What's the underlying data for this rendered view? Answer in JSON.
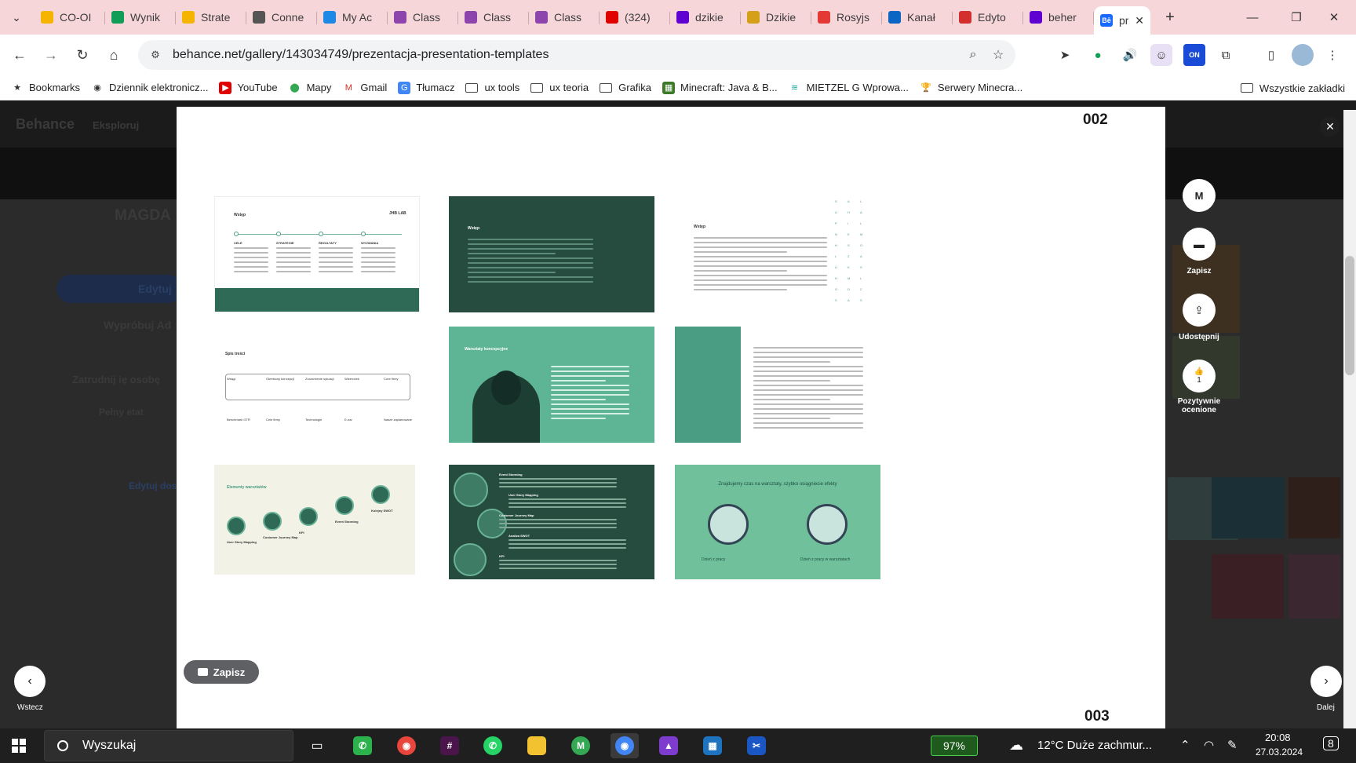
{
  "browser": {
    "tabs": [
      {
        "title": "CO-OI",
        "icon": "google-drive-icon",
        "color": "#f4b400"
      },
      {
        "title": "Wynik",
        "icon": "google-drive-icon",
        "color": "#0f9d58"
      },
      {
        "title": "Strate",
        "icon": "google-slides-icon",
        "color": "#f4b400"
      },
      {
        "title": "Conne",
        "icon": "apple-icon",
        "color": "#555555"
      },
      {
        "title": "My Ac",
        "icon": "grid-app-icon",
        "color": "#1e88e5"
      },
      {
        "title": "Class",
        "icon": "class-icon",
        "color": "#8e44ad"
      },
      {
        "title": "Class",
        "icon": "class-icon",
        "color": "#8e44ad"
      },
      {
        "title": "Class",
        "icon": "class-icon",
        "color": "#8e44ad"
      },
      {
        "title": "(324)",
        "icon": "youtube-icon",
        "color": "#e00000"
      },
      {
        "title": "dzikie",
        "icon": "yahoo-icon",
        "color": "#5f01d1"
      },
      {
        "title": "Dzikie",
        "icon": "brain-icon",
        "color": "#d4a017"
      },
      {
        "title": "Rosyjs",
        "icon": "dots-icon",
        "color": "#e53935"
      },
      {
        "title": "Kanał",
        "icon": "linkedin-icon",
        "color": "#0a66c2"
      },
      {
        "title": "Edyto",
        "icon": "nm-icon",
        "color": "#d32f2f"
      },
      {
        "title": "beher",
        "icon": "yahoo-icon",
        "color": "#5f01d1"
      }
    ],
    "active_tab": {
      "title": "pr",
      "icon": "behance-icon",
      "color": "#1769ff",
      "badge": "Bē"
    },
    "url": "behance.net/gallery/143034749/prezentacja-presentation-templates",
    "bookmarks": [
      {
        "label": "Bookmarks",
        "icon": "star-icon"
      },
      {
        "label": "Dziennik elektronicz...",
        "icon": "globe-icon"
      },
      {
        "label": "YouTube",
        "icon": "youtube-icon"
      },
      {
        "label": "Mapy",
        "icon": "maps-icon"
      },
      {
        "label": "Gmail",
        "icon": "gmail-icon"
      },
      {
        "label": "Tłumacz",
        "icon": "translate-icon"
      },
      {
        "label": "ux tools",
        "icon": "folder-icon"
      },
      {
        "label": "ux teoria",
        "icon": "folder-icon"
      },
      {
        "label": "Grafika",
        "icon": "folder-icon"
      },
      {
        "label": "Minecraft: Java & B...",
        "icon": "minecraft-icon"
      },
      {
        "label": "MIETZEL G Wprowa...",
        "icon": "layers-icon"
      },
      {
        "label": "Serwery Minecra...",
        "icon": "trophy-icon"
      }
    ],
    "all_bookmarks": "Wszystkie zakładki"
  },
  "background_page": {
    "logo": "Behance",
    "explore": "Eksploruj",
    "name": "MAGDA",
    "edit": "Edytuj",
    "try": "Wypróbuj Ad",
    "hire": "Zatrudnij ię osobę",
    "fulltime": "Pełny etat",
    "edit2": "Edytuj dos"
  },
  "modal": {
    "page_top": "002",
    "page_bottom": "003",
    "save_button": "Zapisz",
    "slides": {
      "s1_title": "Wstęp",
      "s1_brand": "JHB LAB",
      "s1_cols": [
        "CELE",
        "STRATEGIE",
        "REZULTATY",
        "WYZWANIA"
      ],
      "s2_title": "Wstęp",
      "s3_title": "Wstęp",
      "s4_title": "Spis treści",
      "s4_items": [
        "Wstęp",
        "Określony koncepcji",
        "Zrozumienie sytuacji",
        "Wizerunek",
        "Core firmy"
      ],
      "s4_items2": [
        "Benchmark GTR",
        "Cele firmy",
        "Technologie",
        "E-nar",
        "Nasze zaplanowane"
      ],
      "s5_title": "Warsztaty koncepcyjne",
      "s7_title": "Elementy warsztatów",
      "s7_steps": [
        "User Story Mapping",
        "Customer Journey Map",
        "KPI",
        "Event Storming",
        "Kolejny SWOT"
      ],
      "s8_heads": [
        "Event Storming",
        "User Story Mapping",
        "Customer Journey Map",
        "Analiza SWOT",
        "KPI"
      ],
      "s9_title": "Znajdujemy czas na warsztaty, szybko osiągniecie efekty",
      "s9_left": "Dzień z pracy",
      "s9_right": "Dzień z pracy w warsztatach"
    }
  },
  "side_panel": {
    "save": "Zapisz",
    "share": "Udostępnij",
    "appreciate_count": "1",
    "appreciate": "Pozytywnie ocenione",
    "prev": "Wstecz",
    "next": "Dalej"
  },
  "taskbar": {
    "search": "Wyszukaj",
    "battery": "97%",
    "weather": "12°C  Duże zachmur...",
    "time": "20:08",
    "date": "27.03.2024",
    "notifications": "8"
  }
}
